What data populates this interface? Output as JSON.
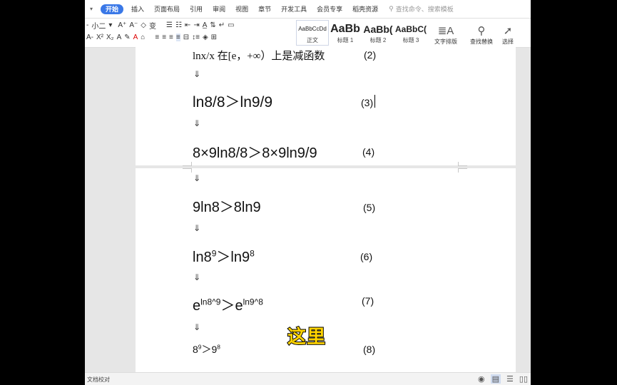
{
  "menubar": {
    "tabs": [
      "开始",
      "插入",
      "页面布局",
      "引用",
      "审阅",
      "视图",
      "章节",
      "开发工具",
      "会员专享",
      "稻壳资源"
    ],
    "active_tab": "开始",
    "search_placeholder": "查找命令、搜索模板"
  },
  "ribbon": {
    "font_size": "小二",
    "styles": [
      {
        "preview": "AaBbCcDd",
        "label": "正文"
      },
      {
        "preview": "AaBb",
        "label": "标题 1"
      },
      {
        "preview": "AaBb(",
        "label": "标题 2"
      },
      {
        "preview": "AaBbC(",
        "label": "标题 3"
      }
    ],
    "text_layout_label": "文字排版",
    "find_replace_label": "查找替换",
    "select_label": "选择"
  },
  "document": {
    "line2_text": "lnx/x 在[e，+∞）上是减函数",
    "line2_num": "(2)",
    "arrow": "⇓",
    "line3_text": "ln8/8＞ln9/9",
    "line3_num": "(3)",
    "line4_text": "8×9ln8/8＞8×9ln9/9",
    "line4_num": "(4)",
    "line5_text": "9ln8＞8ln9",
    "line5_num": "(5)",
    "line6": {
      "a": "ln8",
      "a_exp": "9",
      "op": "＞",
      "b": "ln9",
      "b_exp": "8"
    },
    "line6_num": "(6)",
    "line7": {
      "a": "e",
      "a_exp": "ln8^9",
      "op": "＞",
      "b": "e",
      "b_exp": "ln9^8"
    },
    "line7_num": "(7)",
    "line8": {
      "a": "8",
      "a_exp": "9",
      "op": "＞",
      "b": "9",
      "b_exp": "8"
    },
    "line8_num": "(8)"
  },
  "overlay_text": "这里",
  "status": {
    "left_label": "文档校对"
  }
}
